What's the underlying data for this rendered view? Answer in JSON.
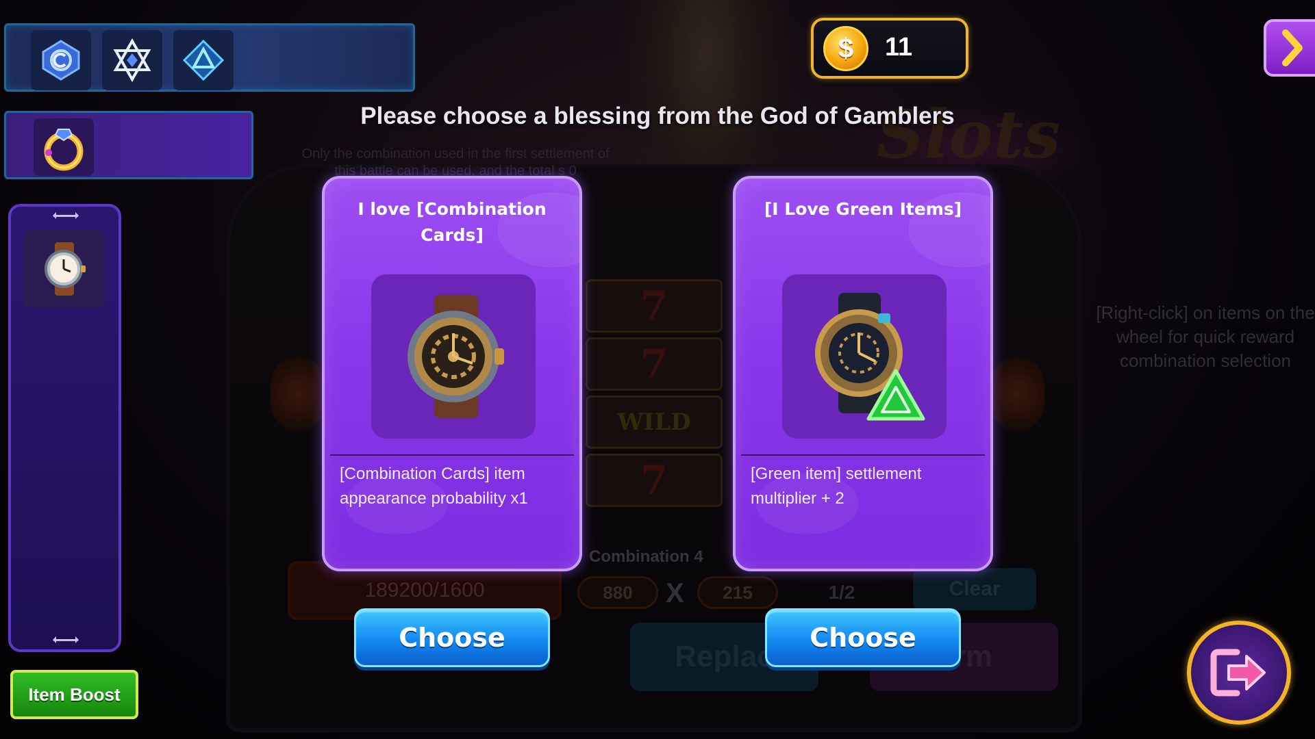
{
  "header": {
    "coin_count": "11",
    "coin_symbol": "$",
    "heading": "Please choose a blessing from the God of Gamblers"
  },
  "skills": {
    "icons": [
      "blue-rune-icon",
      "star-of-david-icon",
      "triangle-rune-icon"
    ]
  },
  "equipment": {
    "icon": "gold-ring-icon"
  },
  "inventory": {
    "items": [
      "wristwatch-icon"
    ]
  },
  "buttons": {
    "item_boost": "Item Boost"
  },
  "cards": [
    {
      "title": "I love [Combination Cards]",
      "image": "steampunk-watch-icon",
      "description": "[Combination Cards] item appearance probability x1",
      "button": "Choose"
    },
    {
      "title": "[I Love Green Items]",
      "image": "dark-watch-with-green-arrow-icon",
      "description": "[Green item] settlement multiplier + 2",
      "button": "Choose"
    }
  ],
  "background": {
    "hint": "[Right-click] on items on the wheel for quick reward combination selection",
    "note": "Only the combination used in the first settlement of this battle can be used, and the total",
    "note_tail": "s 0",
    "score": "189200/1600",
    "combination_label": "Combination 4",
    "multiplier_left": "880",
    "multiplier_sign": "X",
    "multiplier_right": "215",
    "fraction": "1/2",
    "clear": "Clear",
    "replace": "Replac",
    "confirm": "firm",
    "logo": "Slots",
    "reel_symbols": [
      "7",
      "7",
      "WILD",
      "7"
    ]
  },
  "colors": {
    "card_purple": "#8a37ea",
    "choose_blue": "#1388f0",
    "coin_gold": "#f0b32a",
    "boost_green": "#2fbd25",
    "upgrade_green": "#22c83a"
  }
}
